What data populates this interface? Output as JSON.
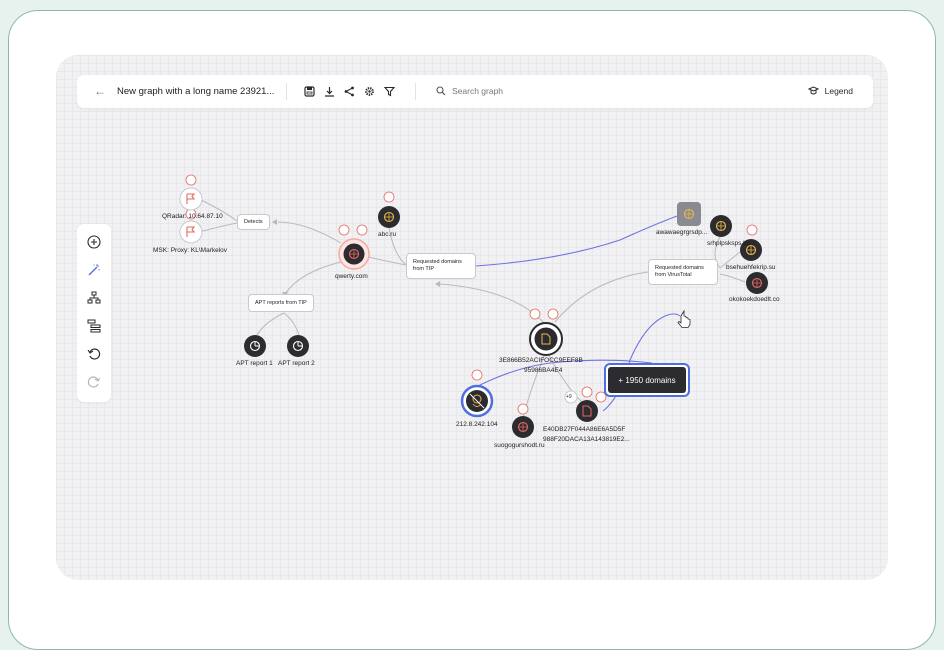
{
  "header": {
    "back_icon": "arrow-left-icon",
    "title": "New graph with a long name 23921...",
    "tools": [
      "save-icon",
      "download-icon",
      "share-icon",
      "settings-icon",
      "filter-icon"
    ],
    "search_placeholder": "Search graph",
    "legend_label": "Legend"
  },
  "sidebar": {
    "tools": [
      "add-node-icon",
      "magic-wand-icon",
      "hierarchy-layout-icon",
      "tree-layout-icon",
      "undo-icon",
      "redo-icon"
    ]
  },
  "graph": {
    "nodes": {
      "qradar": "QRadar: 10.64.87.10",
      "msk": "MSK: Proxy: KL\\Markelov",
      "detects": "Detects",
      "qwerty": "qwerty.com",
      "abc": "abc.ru",
      "req_tip": "Requested domains\nfrom TIP",
      "apt_tip": "APT reports from TIP",
      "apt1": "APT report 1",
      "apt2": "APT report 2",
      "awawae": "awawaegrgrsdp...",
      "srhp": "srhplpsksps kp...",
      "bsehu": "bsehuehfekrip.su",
      "okok": "okokoekdoedlt.co",
      "req_vt": "Requested domains\nfrom VirusTotal",
      "hash1_line1": "3E866B52ACIFOCC9EEF8B",
      "hash1_line2": "95986BA4E4",
      "ip": "212.8.242.104",
      "suo": "suogogurshodt.ru",
      "hash2_line1": "E40DB27F044A86E6A5D5F",
      "hash2_line2": "988F20DACA13A143819E2...",
      "count_badge": "+9",
      "aggregate": "+ 1950 domains"
    }
  },
  "colors": {
    "accent": "#5b6fe0",
    "alert": "#e56a5e",
    "node_dark": "#2b2b30",
    "domain_globe": "#e8b84a"
  }
}
